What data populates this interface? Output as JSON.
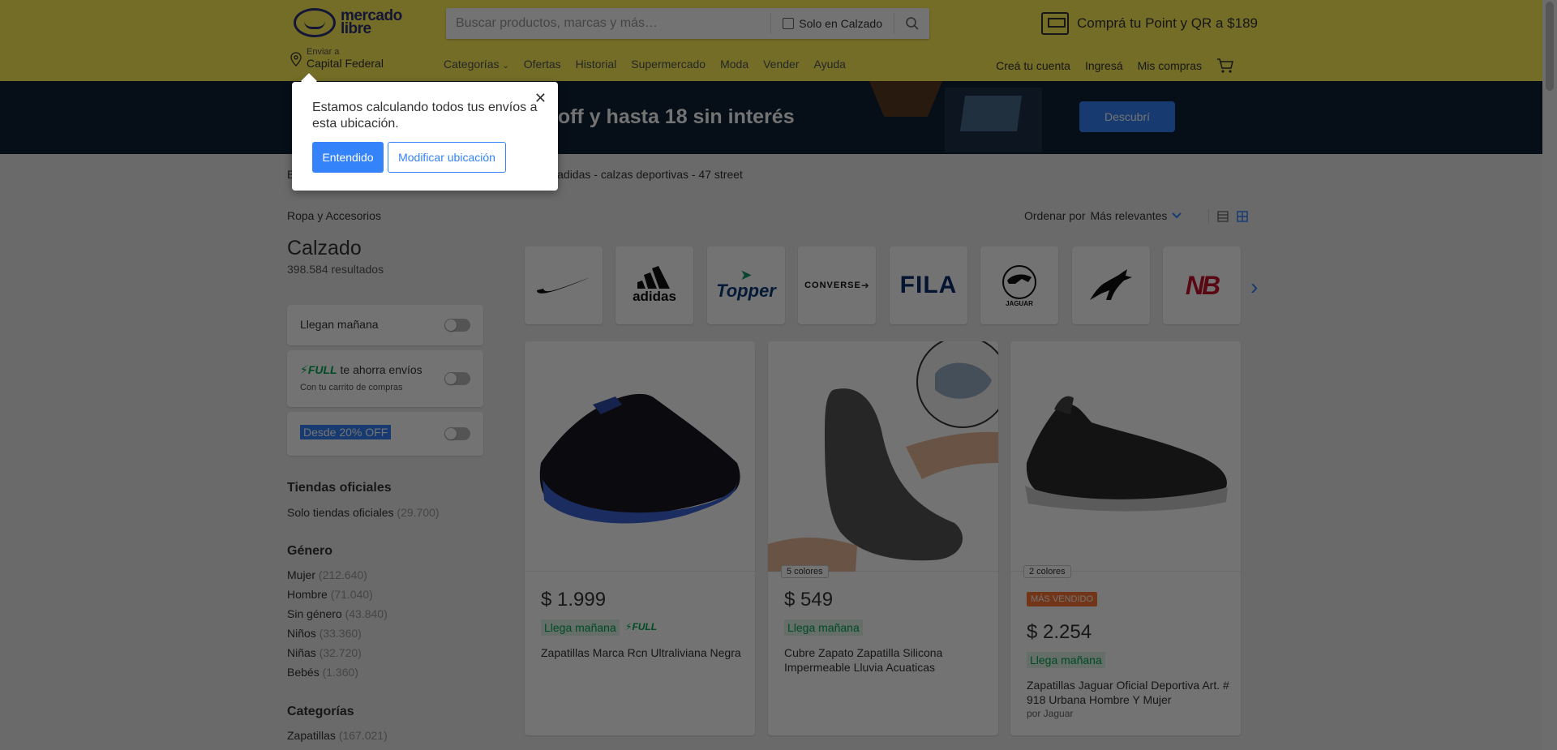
{
  "header": {
    "logo_text": "mercado libre",
    "search_placeholder": "Buscar productos, marcas y más…",
    "search_filter_label": "Solo en Calzado",
    "promo_text": "Comprá tu Point y QR a $189",
    "location_small": "Enviar a",
    "location_big": "Capital Federal",
    "nav": [
      "Categorías",
      "Ofertas",
      "Historial",
      "Supermercado",
      "Moda",
      "Vender",
      "Ayuda"
    ],
    "nav_right": [
      "Creá tu cuenta",
      "Ingresá",
      "Mis compras"
    ]
  },
  "banner": {
    "text": "a 40% off y hasta 18 sin interés",
    "button": "Descubrí"
  },
  "breadcrumb": {
    "text": "adidas  -  calzas deportivas  -  47 street",
    "lead": "B"
  },
  "popup": {
    "text": "Estamos calculando todos tus envíos a esta ubicación.",
    "primary": "Entendido",
    "secondary": "Modificar ubicación"
  },
  "sidebar": {
    "category": "Ropa y Accesorios",
    "title": "Calzado",
    "results": "398.584 resultados",
    "filters": {
      "llegan": "Llegan mañana",
      "full_word": "FULL",
      "full_rest": "te ahorra envíos",
      "full_sub": "Con tu carrito de compras",
      "off": "Desde 20% OFF"
    },
    "tiendas": {
      "title": "Tiendas oficiales",
      "label": "Solo tiendas oficiales",
      "count": "(29.700)"
    },
    "genero": {
      "title": "Género",
      "items": [
        {
          "label": "Mujer",
          "count": "(212.640)"
        },
        {
          "label": "Hombre",
          "count": "(71.040)"
        },
        {
          "label": "Sin género",
          "count": "(43.840)"
        },
        {
          "label": "Niños",
          "count": "(33.360)"
        },
        {
          "label": "Niñas",
          "count": "(32.720)"
        },
        {
          "label": "Bebés",
          "count": "(1.360)"
        }
      ]
    },
    "categorias": {
      "title": "Categorías",
      "items": [
        {
          "label": "Zapatillas",
          "count": "(167.021)"
        }
      ]
    }
  },
  "sort": {
    "label": "Ordenar por",
    "value": "Más relevantes"
  },
  "brands": [
    "nike",
    "adidas",
    "Topper",
    "CONVERSE",
    "FILA",
    "JAGUAR",
    "PUMA",
    "NB"
  ],
  "products": [
    {
      "price": "$ 1.999",
      "shipping": "Llega mañana",
      "full": "FULL",
      "title": "Zapatillas Marca Rcn Ultraliviana Negra"
    },
    {
      "colors": "5 colores",
      "price": "$ 549",
      "shipping": "Llega mañana",
      "title": "Cubre Zapato Zapatilla Silicona Impermeable Lluvia Acuaticas"
    },
    {
      "colors": "2 colores",
      "badge": "MÁS VENDIDO",
      "price": "$ 2.254",
      "shipping": "Llega mañana",
      "title": "Zapatillas Jaguar Oficial Deportiva Art. # 918 Urbana Hombre Y Mujer",
      "by": "por Jaguar"
    }
  ]
}
